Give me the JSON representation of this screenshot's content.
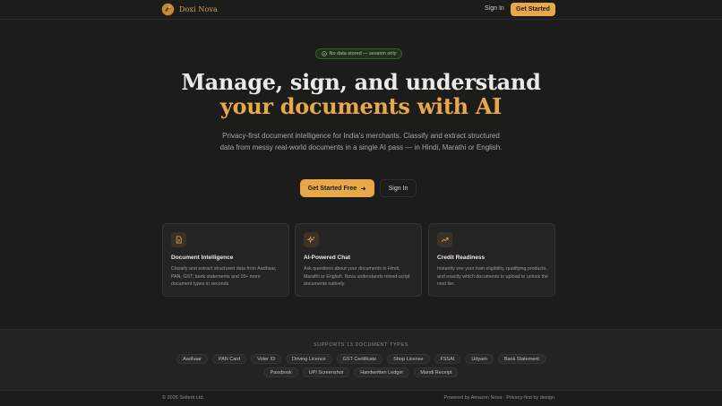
{
  "header": {
    "brand": "Doxi Nova",
    "sign_in": "Sign In",
    "get_started": "Get Started"
  },
  "hero": {
    "badge": "No data stored — session only",
    "title_line1": "Manage, sign, and understand",
    "title_line2": "your documents with AI",
    "subtitle": "Privacy-first document intelligence for India's merchants. Classify and extract structured data from messy real-world documents in a single AI pass — in Hindi, Marathi or English.",
    "cta_primary": "Get Started Free",
    "cta_secondary": "Sign In"
  },
  "features": [
    {
      "icon": "document-icon",
      "title": "Document Intelligence",
      "description": "Classify and extract structured data from Aadhaar, PAN, GST, bank statements and 10+ more document types in seconds."
    },
    {
      "icon": "sparkles-icon",
      "title": "AI-Powered Chat",
      "description": "Ask questions about your documents in Hindi, Marathi or English. Nova understands mixed-script documents natively."
    },
    {
      "icon": "trending-up-icon",
      "title": "Credit Readiness",
      "description": "Instantly see your loan eligibility, qualifying products, and exactly which documents to upload to unlock the next tier."
    }
  ],
  "supports": {
    "title": "SUPPORTS 13 DOCUMENT TYPES",
    "types": [
      "Aadhaar",
      "PAN Card",
      "Voter ID",
      "Driving Licence",
      "GST Certificate",
      "Shop License",
      "FSSAI",
      "Udyam",
      "Bank Statement",
      "Passbook",
      "UPI Screenshot",
      "Handwritten Ledger",
      "Mandi Receipt"
    ]
  },
  "footer": {
    "copyright": "© 2026 Seilent Ltd.",
    "powered": "Powered by Amazon Nova · Privacy-first by design"
  },
  "colors": {
    "accent": "#e8a84a",
    "background": "#1c1c1b",
    "badge_green": "#9fcf8f"
  }
}
